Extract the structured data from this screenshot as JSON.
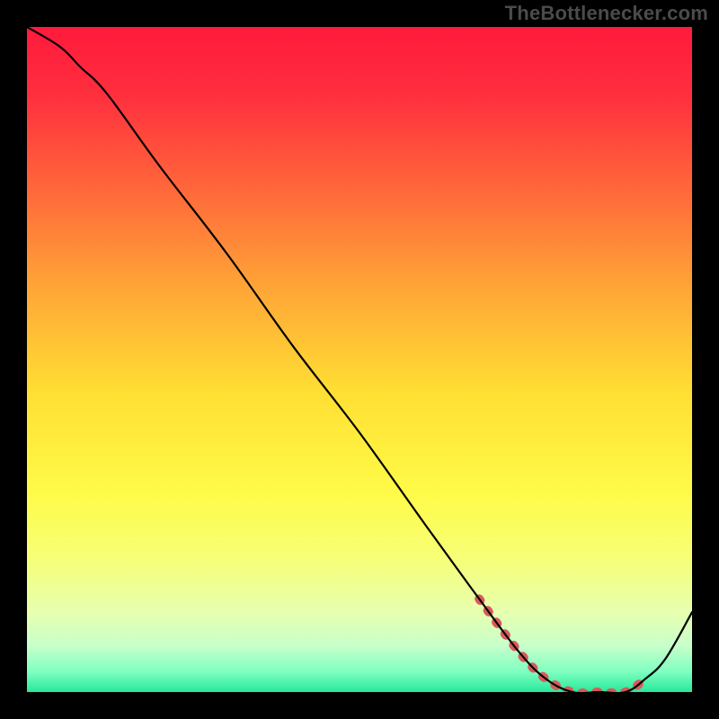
{
  "watermark": "TheBottlenecker.com",
  "gradient": {
    "stops": [
      {
        "offset": 0.0,
        "color": "#ff1a3c"
      },
      {
        "offset": 0.1,
        "color": "#ff2e3e"
      },
      {
        "offset": 0.25,
        "color": "#ff6a3a"
      },
      {
        "offset": 0.4,
        "color": "#ffa836"
      },
      {
        "offset": 0.55,
        "color": "#ffdf33"
      },
      {
        "offset": 0.7,
        "color": "#fffb48"
      },
      {
        "offset": 0.8,
        "color": "#f6ff77"
      },
      {
        "offset": 0.88,
        "color": "#e7ffb0"
      },
      {
        "offset": 0.93,
        "color": "#c8ffca"
      },
      {
        "offset": 0.97,
        "color": "#7dffc0"
      },
      {
        "offset": 1.0,
        "color": "#25e89a"
      }
    ]
  },
  "chart_data": {
    "type": "line",
    "title": "",
    "xlabel": "",
    "ylabel": "",
    "xlim": [
      0,
      100
    ],
    "ylim": [
      0,
      100
    ],
    "series": [
      {
        "name": "curve",
        "x": [
          0,
          5,
          8,
          12,
          20,
          30,
          40,
          50,
          60,
          68,
          74,
          78,
          82,
          86,
          90,
          93,
          96,
          100
        ],
        "y": [
          100,
          97,
          94,
          90,
          79,
          66,
          52,
          39,
          25,
          14,
          6,
          2,
          0,
          0,
          0,
          2,
          5,
          12
        ]
      }
    ],
    "dashed_segment": {
      "x": [
        68,
        74,
        78,
        82,
        86,
        90,
        93
      ],
      "y": [
        14,
        6,
        2,
        0,
        0,
        0,
        2
      ],
      "color": "#d85a5a",
      "width": 10
    },
    "curve_style": {
      "color": "#000000",
      "width": 2.2
    }
  }
}
